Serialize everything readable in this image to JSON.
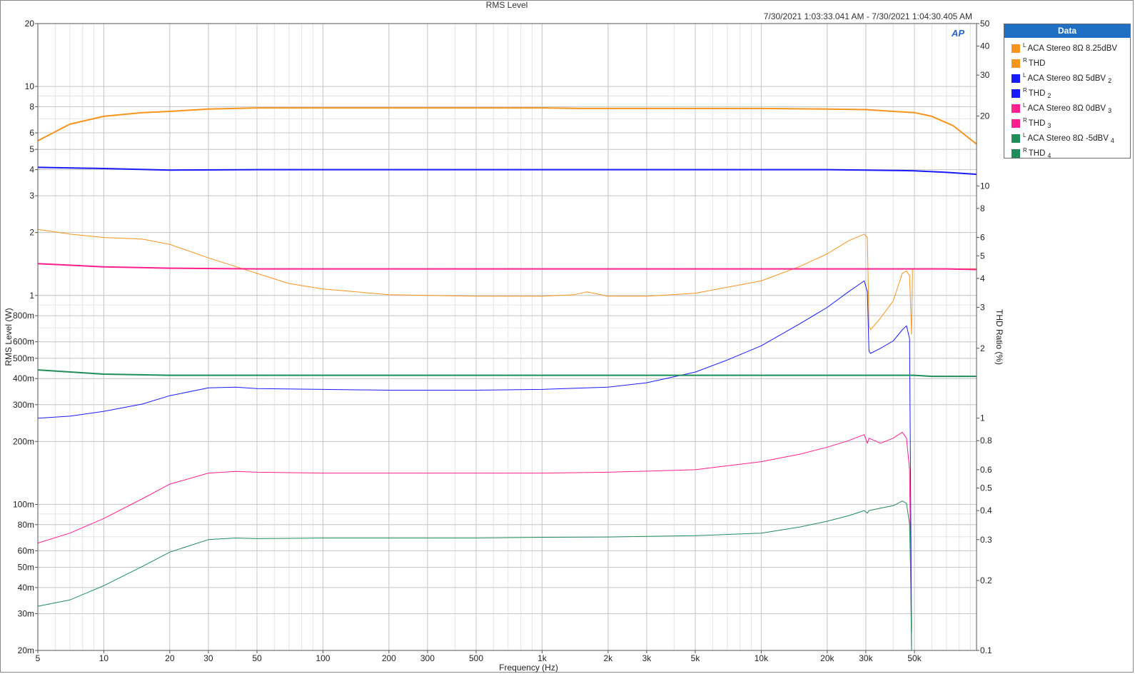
{
  "chart_data": {
    "type": "line",
    "title": "RMS Level",
    "timestamp": "7/30/2021 1:03:33.041 AM - 7/30/2021 1:04:30.405 AM",
    "xlabel": "Frequency (Hz)",
    "ylabel": "RMS Level (W)",
    "y2label": "THD Ratio (%)",
    "xscale": "log",
    "yscale": "log",
    "y2scale": "log",
    "xlim": [
      5,
      96000
    ],
    "ylim": [
      0.02,
      20
    ],
    "y2lim": [
      0.1,
      50
    ],
    "x_ticks": [
      {
        "v": 5,
        "label": "5"
      },
      {
        "v": 10,
        "label": "10"
      },
      {
        "v": 20,
        "label": "20"
      },
      {
        "v": 30,
        "label": "30"
      },
      {
        "v": 50,
        "label": "50"
      },
      {
        "v": 100,
        "label": "100"
      },
      {
        "v": 200,
        "label": "200"
      },
      {
        "v": 300,
        "label": "300"
      },
      {
        "v": 500,
        "label": "500"
      },
      {
        "v": 1000,
        "label": "1k"
      },
      {
        "v": 2000,
        "label": "2k"
      },
      {
        "v": 3000,
        "label": "3k"
      },
      {
        "v": 5000,
        "label": "5k"
      },
      {
        "v": 10000,
        "label": "10k"
      },
      {
        "v": 20000,
        "label": "20k"
      },
      {
        "v": 30000,
        "label": "30k"
      },
      {
        "v": 50000,
        "label": "50k"
      }
    ],
    "y_ticks": [
      {
        "v": 20,
        "label": "20"
      },
      {
        "v": 10,
        "label": "10"
      },
      {
        "v": 8,
        "label": "8"
      },
      {
        "v": 6,
        "label": "6"
      },
      {
        "v": 5,
        "label": "5"
      },
      {
        "v": 4,
        "label": "4"
      },
      {
        "v": 3,
        "label": "3"
      },
      {
        "v": 2,
        "label": "2"
      },
      {
        "v": 1,
        "label": "1"
      },
      {
        "v": 0.8,
        "label": "800m"
      },
      {
        "v": 0.6,
        "label": "600m"
      },
      {
        "v": 0.5,
        "label": "500m"
      },
      {
        "v": 0.4,
        "label": "400m"
      },
      {
        "v": 0.3,
        "label": "300m"
      },
      {
        "v": 0.2,
        "label": "200m"
      },
      {
        "v": 0.1,
        "label": "100m"
      },
      {
        "v": 0.08,
        "label": "80m"
      },
      {
        "v": 0.06,
        "label": "60m"
      },
      {
        "v": 0.05,
        "label": "50m"
      },
      {
        "v": 0.04,
        "label": "40m"
      },
      {
        "v": 0.03,
        "label": "30m"
      },
      {
        "v": 0.02,
        "label": "20m"
      }
    ],
    "y2_ticks": [
      {
        "v": 50,
        "label": "50"
      },
      {
        "v": 40,
        "label": "40"
      },
      {
        "v": 30,
        "label": "30"
      },
      {
        "v": 20,
        "label": "20"
      },
      {
        "v": 10,
        "label": "10"
      },
      {
        "v": 8,
        "label": "8"
      },
      {
        "v": 6,
        "label": "6"
      },
      {
        "v": 5,
        "label": "5"
      },
      {
        "v": 4,
        "label": "4"
      },
      {
        "v": 3,
        "label": "3"
      },
      {
        "v": 2,
        "label": "2"
      },
      {
        "v": 1,
        "label": "1"
      },
      {
        "v": 0.8,
        "label": "0.8"
      },
      {
        "v": 0.6,
        "label": "0.6"
      },
      {
        "v": 0.5,
        "label": "0.5"
      },
      {
        "v": 0.4,
        "label": "0.4"
      },
      {
        "v": 0.3,
        "label": "0.3"
      },
      {
        "v": 0.2,
        "label": "0.2"
      },
      {
        "v": 0.1,
        "label": "0.1"
      }
    ],
    "grid": true,
    "legend_title": "Data",
    "legend_position": "right",
    "series": [
      {
        "name": "ACA Stereo 8Ω 8.25dBV",
        "channel": "L",
        "axis": "left",
        "color": "#f7941d",
        "width": 2,
        "x": [
          5,
          7,
          10,
          15,
          20,
          30,
          50,
          100,
          200,
          500,
          1000,
          1500,
          2000,
          5000,
          10000,
          20000,
          30000,
          40000,
          50000,
          60000,
          75000,
          96000
        ],
        "y": [
          5.5,
          6.6,
          7.2,
          7.5,
          7.6,
          7.8,
          7.9,
          7.9,
          7.9,
          7.9,
          7.9,
          7.85,
          7.85,
          7.85,
          7.85,
          7.8,
          7.75,
          7.6,
          7.5,
          7.2,
          6.5,
          5.3
        ]
      },
      {
        "name": "THD",
        "channel": "R",
        "axis": "right",
        "color": "#f7941d",
        "width": 1,
        "x": [
          5,
          7,
          10,
          15,
          20,
          30,
          50,
          70,
          100,
          200,
          500,
          1000,
          1400,
          1600,
          2000,
          3000,
          5000,
          10000,
          15000,
          20000,
          25000,
          29500,
          30500,
          31000,
          31500,
          35000,
          40000,
          44000,
          46000,
          47500,
          48500,
          49000,
          50000,
          96000
        ],
        "y": [
          6.5,
          6.2,
          6.0,
          5.9,
          5.6,
          4.9,
          4.2,
          3.8,
          3.6,
          3.4,
          3.35,
          3.35,
          3.4,
          3.5,
          3.35,
          3.35,
          3.45,
          3.9,
          4.5,
          5.1,
          5.8,
          6.2,
          6.0,
          2.5,
          2.4,
          2.7,
          3.2,
          4.2,
          4.3,
          4.1,
          2.3,
          4.4,
          4.4,
          4.4
        ]
      },
      {
        "name": "ACA Stereo 8Ω 5dBV",
        "channel": "L",
        "axis": "left",
        "color": "#1a1aff",
        "width": 2,
        "suffix": "2",
        "x": [
          5,
          10,
          20,
          50,
          1000,
          20000,
          30000,
          50000,
          70000,
          96000
        ],
        "y": [
          4.1,
          4.05,
          3.98,
          4.0,
          4.0,
          4.0,
          3.98,
          3.95,
          3.88,
          3.8
        ]
      },
      {
        "name": "THD",
        "channel": "R",
        "axis": "right",
        "color": "#1a1aff",
        "width": 1,
        "suffix": "2",
        "x": [
          5,
          7,
          10,
          15,
          20,
          30,
          40,
          50,
          100,
          200,
          500,
          1000,
          2000,
          3000,
          5000,
          7000,
          10000,
          15000,
          20000,
          25000,
          29500,
          30500,
          31000,
          31500,
          35000,
          40000,
          44000,
          46000,
          47500,
          48500
        ],
        "y": [
          1.0,
          1.02,
          1.07,
          1.15,
          1.25,
          1.35,
          1.36,
          1.34,
          1.33,
          1.32,
          1.32,
          1.33,
          1.36,
          1.42,
          1.58,
          1.78,
          2.05,
          2.55,
          3.0,
          3.5,
          3.9,
          3.5,
          1.95,
          1.9,
          2.0,
          2.15,
          2.4,
          2.5,
          2.2,
          0.12
        ]
      },
      {
        "name": "ACA Stereo 8Ω 0dBV",
        "channel": "L",
        "axis": "left",
        "color": "#ff1f8e",
        "width": 2,
        "suffix": "3",
        "x": [
          5,
          10,
          20,
          50,
          1000,
          20000,
          50000,
          70000,
          96000
        ],
        "y": [
          1.42,
          1.37,
          1.35,
          1.34,
          1.34,
          1.34,
          1.34,
          1.34,
          1.33
        ]
      },
      {
        "name": "THD",
        "channel": "R",
        "axis": "right",
        "color": "#ff1f8e",
        "width": 1,
        "suffix": "3",
        "x": [
          5,
          7,
          10,
          15,
          20,
          30,
          40,
          50,
          100,
          200,
          500,
          1000,
          2000,
          5000,
          10000,
          15000,
          20000,
          25000,
          29500,
          30500,
          31000,
          35000,
          40000,
          44000,
          46000,
          47500,
          48500
        ],
        "y": [
          0.29,
          0.32,
          0.37,
          0.45,
          0.52,
          0.58,
          0.59,
          0.585,
          0.58,
          0.58,
          0.58,
          0.58,
          0.585,
          0.6,
          0.65,
          0.7,
          0.75,
          0.8,
          0.85,
          0.78,
          0.82,
          0.78,
          0.82,
          0.87,
          0.82,
          0.6,
          0.1
        ]
      },
      {
        "name": "ACA Stereo 8Ω -5dBV",
        "channel": "L",
        "axis": "left",
        "color": "#1f8c5a",
        "width": 2,
        "suffix": "4",
        "x": [
          5,
          10,
          20,
          50,
          1000,
          20000,
          50000,
          60000,
          96000
        ],
        "y": [
          0.44,
          0.42,
          0.415,
          0.415,
          0.415,
          0.415,
          0.415,
          0.41,
          0.41
        ]
      },
      {
        "name": "THD",
        "channel": "R",
        "axis": "right",
        "color": "#1f8c5a",
        "width": 1,
        "suffix": "4",
        "x": [
          5,
          7,
          10,
          15,
          20,
          30,
          40,
          50,
          100,
          200,
          500,
          1000,
          2000,
          5000,
          10000,
          15000,
          20000,
          25000,
          29500,
          30500,
          31000,
          35000,
          40000,
          44000,
          46000,
          47500,
          48000,
          48500
        ],
        "y": [
          0.155,
          0.165,
          0.19,
          0.23,
          0.265,
          0.3,
          0.305,
          0.303,
          0.305,
          0.305,
          0.305,
          0.307,
          0.308,
          0.312,
          0.32,
          0.34,
          0.36,
          0.38,
          0.4,
          0.39,
          0.4,
          0.41,
          0.42,
          0.44,
          0.43,
          0.35,
          0.22,
          0.1
        ]
      }
    ]
  }
}
